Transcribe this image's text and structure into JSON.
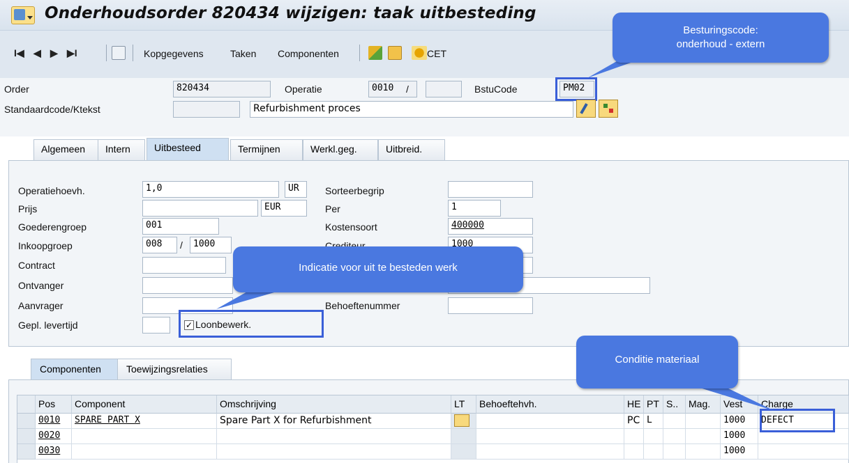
{
  "window": {
    "title": "Onderhoudsorder 820434 wijzigen: taak uitbesteding"
  },
  "toolbar": {
    "nav_first": "I◀",
    "nav_prev": "◀",
    "nav_next": "▶",
    "nav_last": "▶I",
    "buttons": [
      "Kopgegevens",
      "Taken",
      "Componenten"
    ],
    "cet_label": "CET"
  },
  "header": {
    "order_label": "Order",
    "order_value": "820434",
    "operatie_label": "Operatie",
    "operatie_value": "0010",
    "operatie_sep": "/",
    "operatie_sub": "",
    "bstucode_label": "BstuCode",
    "bstucode_value": "PM02",
    "stdcode_label": "Standaardcode/Ktekst",
    "stdcode_value": "",
    "ktekst_value": "Refurbishment proces"
  },
  "tabs": [
    "Algemeen",
    "Intern",
    "Uitbesteed",
    "Termijnen",
    "Werkl.geg.",
    "Uitbreid."
  ],
  "form": {
    "operatiehoevh_label": "Operatiehoevh.",
    "operatiehoevh_value": "1,0",
    "operatiehoevh_unit": "UR",
    "prijs_label": "Prijs",
    "prijs_value": "",
    "prijs_currency": "EUR",
    "goederengroep_label": "Goederengroep",
    "goederengroep_value": "001",
    "inkoopgroep_label": "Inkoopgroep",
    "inkoopgroep_value": "008",
    "inkoopgroep_sep": "/",
    "inkoopgroep_org": "1000",
    "contract_label": "Contract",
    "ontvanger_label": "Ontvanger",
    "aanvrager_label": "Aanvrager",
    "gepl_levertijd_label": "Gepl. levertijd",
    "loonbewerk_label": "Loonbewerk.",
    "loonbewerk_checked": "✓",
    "sorteerbegrip_label": "Sorteerbegrip",
    "per_label": "Per",
    "per_value": "1",
    "kostensoort_label": "Kostensoort",
    "kostensoort_value": "400000",
    "crediteur_label": "Crediteur",
    "crediteur_value": "1000",
    "behoeftenummer_label": "Behoeftenummer"
  },
  "lower_tabs": [
    "Componenten",
    "Toewijzingsrelaties"
  ],
  "table": {
    "columns": [
      "Pos",
      "Component",
      "Omschrijving",
      "LT",
      "Behoeftehvh.",
      "HE",
      "PT",
      "S..",
      "Mag.",
      "Vest",
      "Charge"
    ],
    "rows": [
      {
        "pos": "0010",
        "component": "SPARE PART X",
        "omschrijving": "Spare Part X for Refurbishment",
        "he": "PC",
        "pt": "L",
        "vest": "1000",
        "charge": "DEFECT"
      },
      {
        "pos": "0020",
        "component": "",
        "omschrijving": "",
        "he": "",
        "pt": "",
        "vest": "1000",
        "charge": ""
      },
      {
        "pos": "0030",
        "component": "",
        "omschrijving": "",
        "he": "",
        "pt": "",
        "vest": "1000",
        "charge": ""
      }
    ]
  },
  "callouts": {
    "besturingscode_line1": "Besturingscode:",
    "besturingscode_line2": "onderhoud - extern",
    "indicatie": "Indicatie voor uit te besteden werk",
    "conditie": "Conditie materiaal"
  },
  "colors": {
    "callout": "#4a78e0",
    "highlight": "#3a5fd8"
  }
}
